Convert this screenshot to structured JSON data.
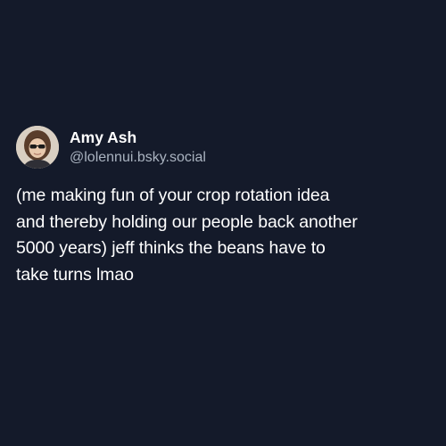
{
  "post": {
    "author": {
      "display_name": "Amy Ash",
      "handle": "@lolennui.bsky.social",
      "avatar_icon": "user-avatar-photo"
    },
    "text": "(me making fun of your crop rotation idea\nand thereby holding our people back another\n5000 years) jeff thinks the beans have to\ntake turns lmao"
  },
  "colors": {
    "background": "#141a2a",
    "text": "#ffffff",
    "handle": "#aab3c0"
  }
}
